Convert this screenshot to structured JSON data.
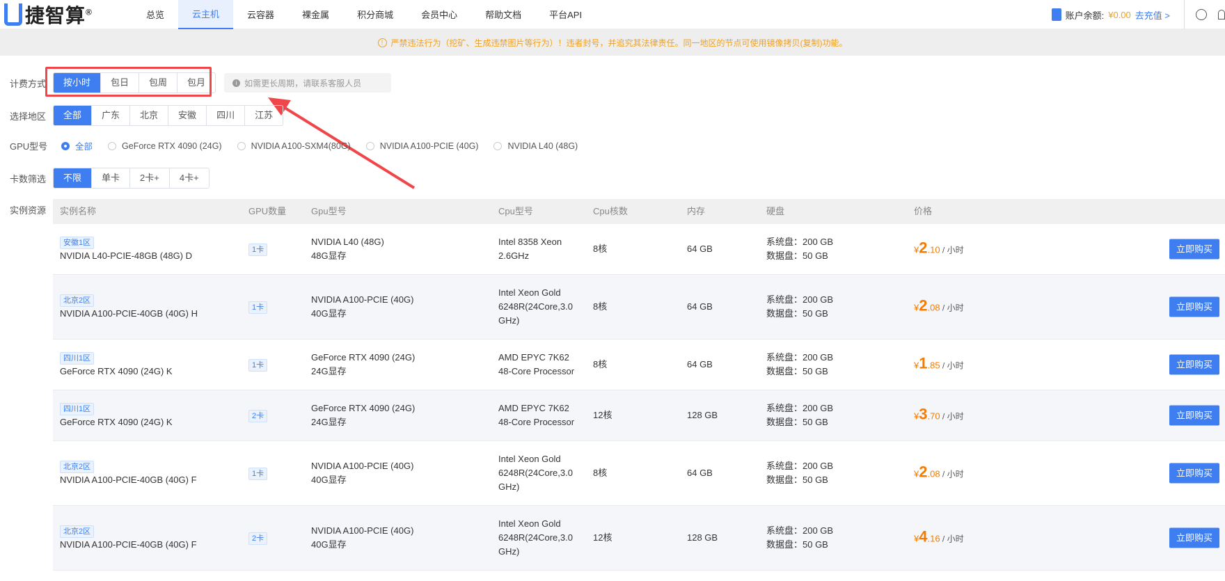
{
  "logo": "捷智算",
  "nav": [
    "总览",
    "云主机",
    "云容器",
    "裸金属",
    "积分商城",
    "会员中心",
    "帮助文档",
    "平台API"
  ],
  "account": {
    "label": "账户余额:",
    "balance": "¥0.00",
    "recharge": "去充值 >"
  },
  "notice": "严禁违法行为（挖矿、生成违禁图片等行为）！违者封号，并追究其法律责任。同一地区的节点可使用镜像拷贝(复制)功能。",
  "billing": {
    "label": "计费方式",
    "options": [
      "按小时",
      "包日",
      "包周",
      "包月"
    ],
    "hint": "如需更长周期，请联系客服人员"
  },
  "region": {
    "label": "选择地区",
    "options": [
      "全部",
      "广东",
      "北京",
      "安徽",
      "四川",
      "江苏"
    ]
  },
  "gpu": {
    "label": "GPU型号",
    "options": [
      "全部",
      "GeForce RTX 4090 (24G)",
      "NVIDIA A100-SXM4(80G)",
      "NVIDIA A100-PCIE (40G)",
      "NVIDIA L40  (48G)"
    ]
  },
  "cards": {
    "label": "卡数筛选",
    "options": [
      "不限",
      "单卡",
      "2卡+",
      "4卡+"
    ]
  },
  "table": {
    "label": "实例资源",
    "headers": [
      "实例名称",
      "GPU数量",
      "Gpu型号",
      "Cpu型号",
      "Cpu核数",
      "内存",
      "硬盘",
      "价格"
    ],
    "buy": "立即购买",
    "unit": " / 小时",
    "yen": "¥",
    "rows": [
      {
        "zone": "安徽1区",
        "name": "NVIDIA L40-PCIE-48GB (48G) D",
        "count": "1卡",
        "gpu": "NVIDIA L40  (48G)",
        "vram": "48G显存",
        "cpu": "Intel 8358 Xeon 2.6GHz",
        "cores": "8核",
        "mem": "64 GB",
        "sys": "系统盘：200 GB",
        "dat": "数据盘：50 GB",
        "int": "2",
        "dec": ".10"
      },
      {
        "zone": "北京2区",
        "name": "NVIDIA A100-PCIE-40GB (40G) H",
        "count": "1卡",
        "gpu": "NVIDIA A100-PCIE (40G)",
        "vram": "40G显存",
        "cpu": "Intel Xeon Gold 6248R(24Core,3.0 GHz)",
        "cores": "8核",
        "mem": "64 GB",
        "sys": "系统盘：200 GB",
        "dat": "数据盘：50 GB",
        "int": "2",
        "dec": ".08"
      },
      {
        "zone": "四川1区",
        "name": "GeForce RTX 4090 (24G) K",
        "count": "1卡",
        "gpu": "GeForce RTX 4090 (24G)",
        "vram": "24G显存",
        "cpu": "AMD EPYC 7K62 48-Core Processor",
        "cores": "8核",
        "mem": "64 GB",
        "sys": "系统盘：200 GB",
        "dat": "数据盘：50 GB",
        "int": "1",
        "dec": ".85"
      },
      {
        "zone": "四川1区",
        "name": "GeForce RTX 4090 (24G) K",
        "count": "2卡",
        "gpu": "GeForce RTX 4090 (24G)",
        "vram": "24G显存",
        "cpu": "AMD EPYC 7K62 48-Core Processor",
        "cores": "12核",
        "mem": "128 GB",
        "sys": "系统盘：200 GB",
        "dat": "数据盘：50 GB",
        "int": "3",
        "dec": ".70"
      },
      {
        "zone": "北京2区",
        "name": "NVIDIA A100-PCIE-40GB (40G) F",
        "count": "1卡",
        "gpu": "NVIDIA A100-PCIE (40G)",
        "vram": "40G显存",
        "cpu": "Intel Xeon Gold 6248R(24Core,3.0 GHz)",
        "cores": "8核",
        "mem": "64 GB",
        "sys": "系统盘：200 GB",
        "dat": "数据盘：50 GB",
        "int": "2",
        "dec": ".08"
      },
      {
        "zone": "北京2区",
        "name": "NVIDIA A100-PCIE-40GB (40G) F",
        "count": "2卡",
        "gpu": "NVIDIA A100-PCIE (40G)",
        "vram": "40G显存",
        "cpu": "Intel Xeon Gold 6248R(24Core,3.0 GHz)",
        "cores": "12核",
        "mem": "128 GB",
        "sys": "系统盘：200 GB",
        "dat": "数据盘：50 GB",
        "int": "4",
        "dec": ".16"
      }
    ]
  },
  "colors": {
    "accent": "#3e7ef0",
    "warning": "#f0a020",
    "price": "#f57c00",
    "highlight": "#f0464a"
  }
}
